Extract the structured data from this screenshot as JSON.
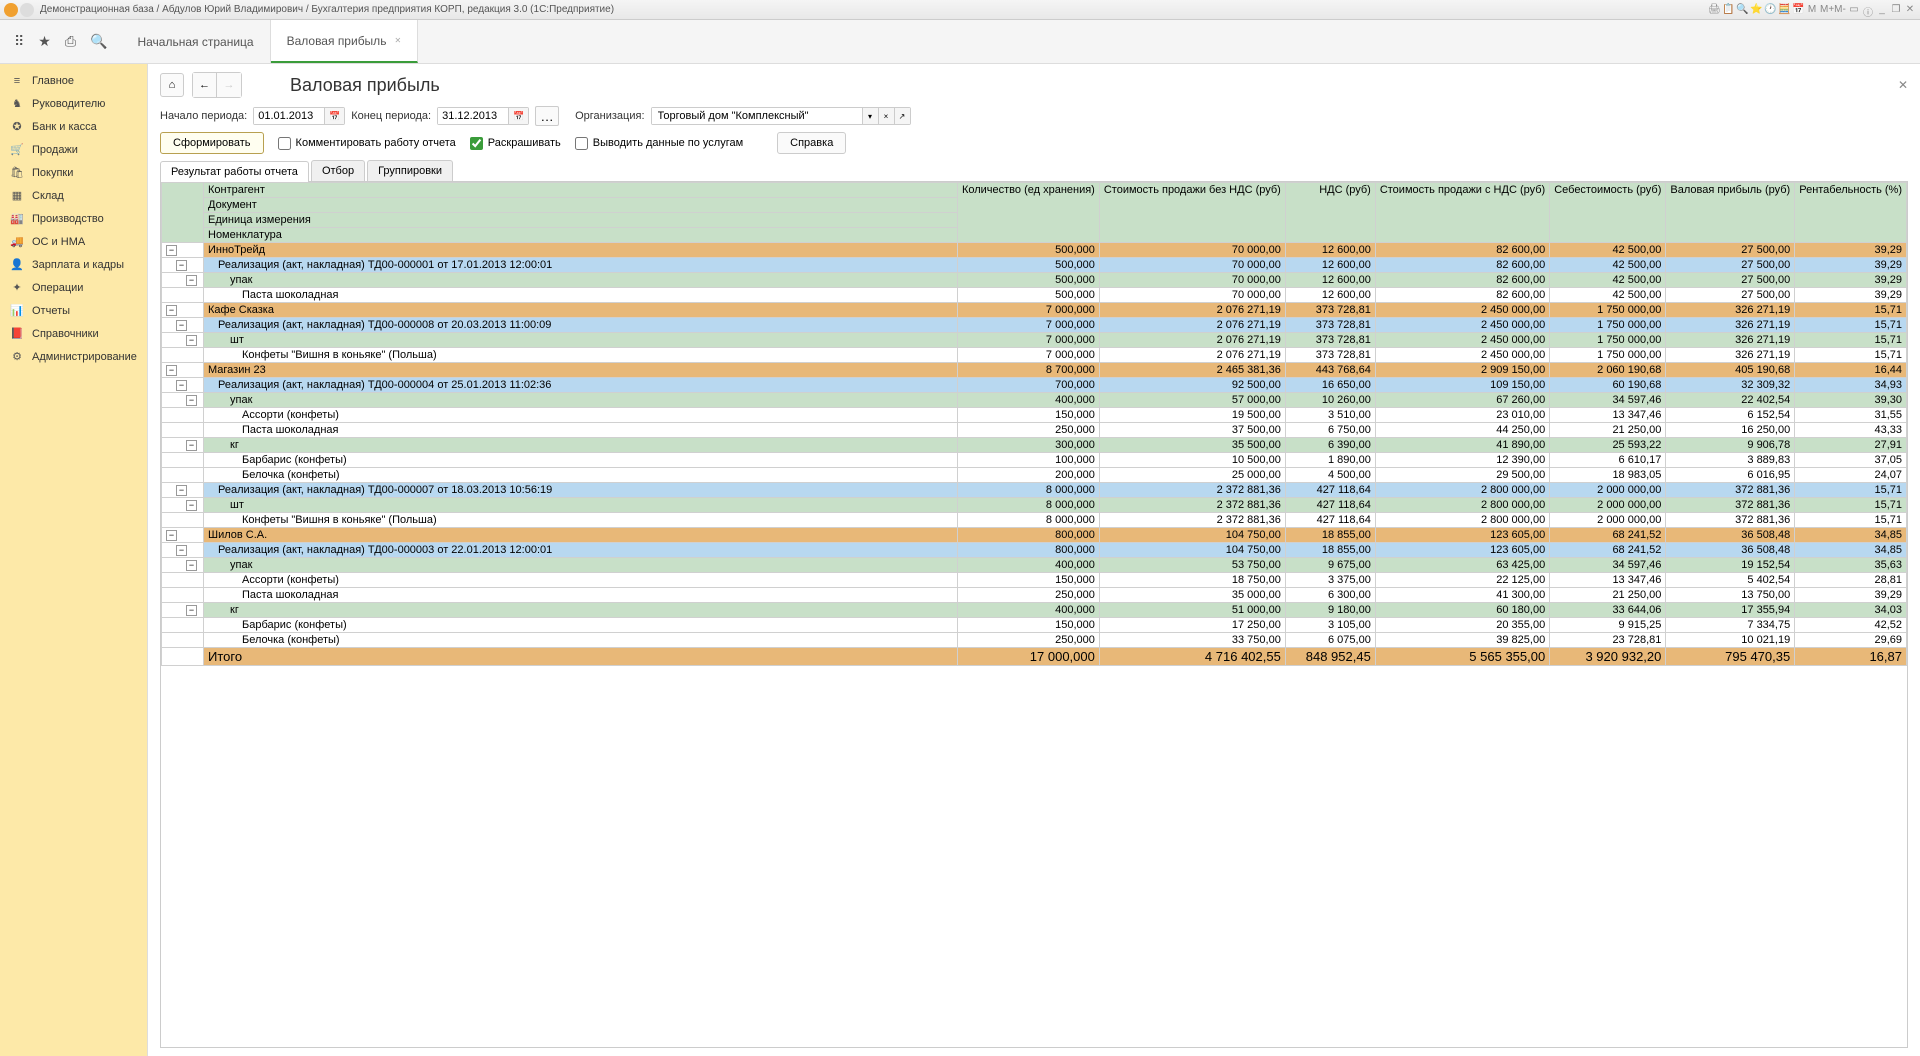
{
  "window": {
    "title": "Демонстрационная база / Абдулов Юрий Владимирович / Бухгалтерия предприятия КОРП, редакция 3.0  (1С:Предприятие)"
  },
  "tabs": {
    "home": "Начальная страница",
    "report": "Валовая прибыль"
  },
  "sidebar": [
    {
      "icon": "≡",
      "label": "Главное"
    },
    {
      "icon": "♞",
      "label": "Руководителю"
    },
    {
      "icon": "✪",
      "label": "Банк и касса"
    },
    {
      "icon": "🛒",
      "label": "Продажи"
    },
    {
      "icon": "🛍",
      "label": "Покупки"
    },
    {
      "icon": "▦",
      "label": "Склад"
    },
    {
      "icon": "🏭",
      "label": "Производство"
    },
    {
      "icon": "🚚",
      "label": "ОС и НМА"
    },
    {
      "icon": "👤",
      "label": "Зарплата и кадры"
    },
    {
      "icon": "✦",
      "label": "Операции"
    },
    {
      "icon": "📊",
      "label": "Отчеты"
    },
    {
      "icon": "📕",
      "label": "Справочники"
    },
    {
      "icon": "⚙",
      "label": "Администрирование"
    }
  ],
  "page": {
    "title": "Валовая прибыль",
    "period_from_label": "Начало периода:",
    "period_from": "01.01.2013",
    "period_to_label": "Конец периода:",
    "period_to": "31.12.2013",
    "org_label": "Организация:",
    "org_value": "Торговый дом \"Комплексный\"",
    "btn_form": "Сформировать",
    "chk_comment": "Комментировать работу отчета",
    "chk_color": "Раскрашивать",
    "chk_services": "Выводить данные по услугам",
    "btn_help": "Справка",
    "rtabs": [
      "Результат работы отчета",
      "Отбор",
      "Группировки"
    ]
  },
  "columns": {
    "c1a": "Контрагент",
    "c1b": "Документ",
    "c1c": "Единица измерения",
    "c1d": "Номенклатура",
    "c2": "Количество (ед хранения)",
    "c3": "Стоимость продажи без НДС (руб)",
    "c4": "НДС (руб)",
    "c5": "Стоимость продажи с НДС (руб)",
    "c6": "Себестоимость (руб)",
    "c7": "Валовая прибыль (руб)",
    "c8": "Рентабельность (%)"
  },
  "rows": [
    {
      "lvl": 0,
      "name": "ИнноТрейд",
      "v": [
        "500,000",
        "70 000,00",
        "12 600,00",
        "82 600,00",
        "42 500,00",
        "27 500,00",
        "39,29"
      ]
    },
    {
      "lvl": 1,
      "name": "Реализация (акт, накладная) ТД00-000001 от 17.01.2013 12:00:01",
      "v": [
        "500,000",
        "70 000,00",
        "12 600,00",
        "82 600,00",
        "42 500,00",
        "27 500,00",
        "39,29"
      ]
    },
    {
      "lvl": 2,
      "name": "упак",
      "v": [
        "500,000",
        "70 000,00",
        "12 600,00",
        "82 600,00",
        "42 500,00",
        "27 500,00",
        "39,29"
      ]
    },
    {
      "lvl": 3,
      "name": "Паста шоколадная",
      "v": [
        "500,000",
        "70 000,00",
        "12 600,00",
        "82 600,00",
        "42 500,00",
        "27 500,00",
        "39,29"
      ]
    },
    {
      "lvl": 0,
      "name": "Кафе Сказка",
      "v": [
        "7 000,000",
        "2 076 271,19",
        "373 728,81",
        "2 450 000,00",
        "1 750 000,00",
        "326 271,19",
        "15,71"
      ]
    },
    {
      "lvl": 1,
      "name": "Реализация (акт, накладная) ТД00-000008 от 20.03.2013 11:00:09",
      "v": [
        "7 000,000",
        "2 076 271,19",
        "373 728,81",
        "2 450 000,00",
        "1 750 000,00",
        "326 271,19",
        "15,71"
      ]
    },
    {
      "lvl": 2,
      "name": "шт",
      "v": [
        "7 000,000",
        "2 076 271,19",
        "373 728,81",
        "2 450 000,00",
        "1 750 000,00",
        "326 271,19",
        "15,71"
      ]
    },
    {
      "lvl": 3,
      "name": "Конфеты \"Вишня в коньяке\"  (Польша)",
      "v": [
        "7 000,000",
        "2 076 271,19",
        "373 728,81",
        "2 450 000,00",
        "1 750 000,00",
        "326 271,19",
        "15,71"
      ]
    },
    {
      "lvl": 0,
      "name": "Магазин 23",
      "v": [
        "8 700,000",
        "2 465 381,36",
        "443 768,64",
        "2 909 150,00",
        "2 060 190,68",
        "405 190,68",
        "16,44"
      ]
    },
    {
      "lvl": 1,
      "name": "Реализация (акт, накладная) ТД00-000004 от 25.01.2013 11:02:36",
      "v": [
        "700,000",
        "92 500,00",
        "16 650,00",
        "109 150,00",
        "60 190,68",
        "32 309,32",
        "34,93"
      ]
    },
    {
      "lvl": 2,
      "name": "упак",
      "v": [
        "400,000",
        "57 000,00",
        "10 260,00",
        "67 260,00",
        "34 597,46",
        "22 402,54",
        "39,30"
      ]
    },
    {
      "lvl": 3,
      "name": "Ассорти (конфеты)",
      "v": [
        "150,000",
        "19 500,00",
        "3 510,00",
        "23 010,00",
        "13 347,46",
        "6 152,54",
        "31,55"
      ]
    },
    {
      "lvl": 3,
      "name": "Паста шоколадная",
      "v": [
        "250,000",
        "37 500,00",
        "6 750,00",
        "44 250,00",
        "21 250,00",
        "16 250,00",
        "43,33"
      ]
    },
    {
      "lvl": 2,
      "name": "кг",
      "v": [
        "300,000",
        "35 500,00",
        "6 390,00",
        "41 890,00",
        "25 593,22",
        "9 906,78",
        "27,91"
      ]
    },
    {
      "lvl": 3,
      "name": "Барбарис (конфеты)",
      "v": [
        "100,000",
        "10 500,00",
        "1 890,00",
        "12 390,00",
        "6 610,17",
        "3 889,83",
        "37,05"
      ]
    },
    {
      "lvl": 3,
      "name": "Белочка (конфеты)",
      "v": [
        "200,000",
        "25 000,00",
        "4 500,00",
        "29 500,00",
        "18 983,05",
        "6 016,95",
        "24,07"
      ]
    },
    {
      "lvl": 1,
      "name": "Реализация (акт, накладная) ТД00-000007 от 18.03.2013 10:56:19",
      "v": [
        "8 000,000",
        "2 372 881,36",
        "427 118,64",
        "2 800 000,00",
        "2 000 000,00",
        "372 881,36",
        "15,71"
      ]
    },
    {
      "lvl": 2,
      "name": "шт",
      "v": [
        "8 000,000",
        "2 372 881,36",
        "427 118,64",
        "2 800 000,00",
        "2 000 000,00",
        "372 881,36",
        "15,71"
      ]
    },
    {
      "lvl": 3,
      "name": "Конфеты \"Вишня в коньяке\"  (Польша)",
      "v": [
        "8 000,000",
        "2 372 881,36",
        "427 118,64",
        "2 800 000,00",
        "2 000 000,00",
        "372 881,36",
        "15,71"
      ]
    },
    {
      "lvl": 0,
      "name": "Шилов С.А.",
      "v": [
        "800,000",
        "104 750,00",
        "18 855,00",
        "123 605,00",
        "68 241,52",
        "36 508,48",
        "34,85"
      ]
    },
    {
      "lvl": 1,
      "name": "Реализация (акт, накладная) ТД00-000003 от 22.01.2013 12:00:01",
      "v": [
        "800,000",
        "104 750,00",
        "18 855,00",
        "123 605,00",
        "68 241,52",
        "36 508,48",
        "34,85"
      ]
    },
    {
      "lvl": 2,
      "name": "упак",
      "v": [
        "400,000",
        "53 750,00",
        "9 675,00",
        "63 425,00",
        "34 597,46",
        "19 152,54",
        "35,63"
      ]
    },
    {
      "lvl": 3,
      "name": "Ассорти (конфеты)",
      "v": [
        "150,000",
        "18 750,00",
        "3 375,00",
        "22 125,00",
        "13 347,46",
        "5 402,54",
        "28,81"
      ]
    },
    {
      "lvl": 3,
      "name": "Паста шоколадная",
      "v": [
        "250,000",
        "35 000,00",
        "6 300,00",
        "41 300,00",
        "21 250,00",
        "13 750,00",
        "39,29"
      ]
    },
    {
      "lvl": 2,
      "name": "кг",
      "v": [
        "400,000",
        "51 000,00",
        "9 180,00",
        "60 180,00",
        "33 644,06",
        "17 355,94",
        "34,03"
      ]
    },
    {
      "lvl": 3,
      "name": "Барбарис (конфеты)",
      "v": [
        "150,000",
        "17 250,00",
        "3 105,00",
        "20 355,00",
        "9 915,25",
        "7 334,75",
        "42,52"
      ]
    },
    {
      "lvl": 3,
      "name": "Белочка (конфеты)",
      "v": [
        "250,000",
        "33 750,00",
        "6 075,00",
        "39 825,00",
        "23 728,81",
        "10 021,19",
        "29,69"
      ]
    }
  ],
  "total": {
    "label": "Итого",
    "v": [
      "17 000,000",
      "4 716 402,55",
      "848 952,45",
      "5 565 355,00",
      "3 920 932,20",
      "795 470,35",
      "16,87"
    ]
  }
}
